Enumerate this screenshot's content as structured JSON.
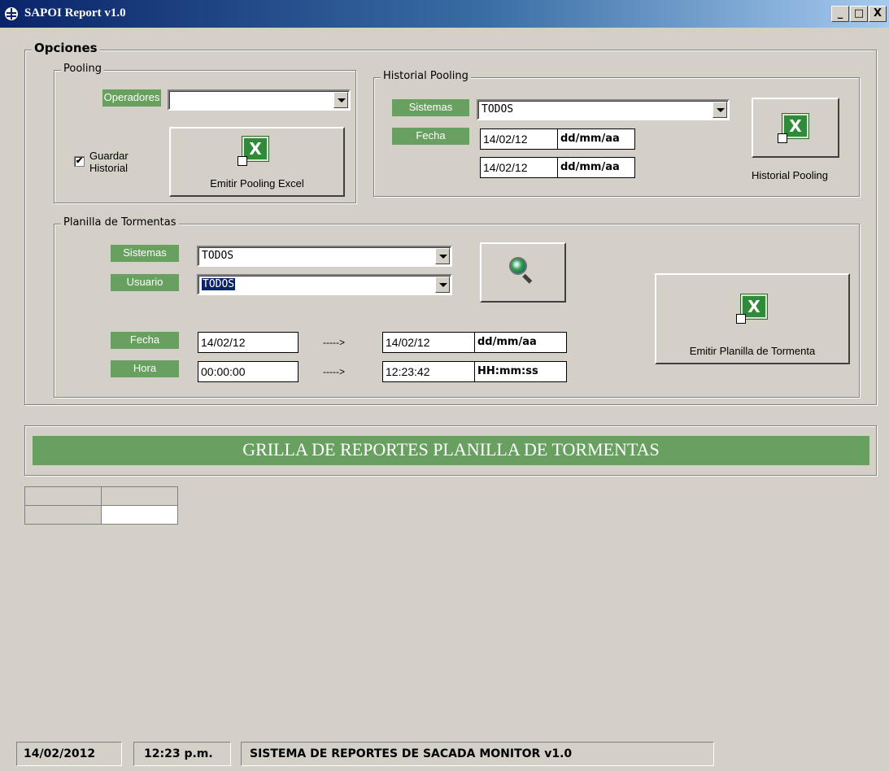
{
  "window": {
    "title": "SAPOI Report v1.0",
    "minimize": "_",
    "maximize": "□",
    "close": "X"
  },
  "opciones": {
    "legend": "Opciones",
    "pooling": {
      "legend": "Pooling",
      "operadores_label": "Operadores",
      "operadores_value": "",
      "guardar_historial_label_1": "Guardar",
      "guardar_historial_label_2": "Historial",
      "guardar_checked": "✔",
      "emitir_button": "Emitir Pooling Excel"
    },
    "historial": {
      "legend": "Historial Pooling",
      "sistemas_label": "Sistemas",
      "sistemas_value": "TODOS",
      "fecha_label": "Fecha",
      "fecha_desde": "14/02/12",
      "fecha_hasta": "14/02/12",
      "date_format": "dd/mm/aa",
      "button_label": "Historial Pooling"
    },
    "planilla": {
      "legend": "Planilla de Tormentas",
      "sistemas_label": "Sistemas",
      "sistemas_value": "TODOS",
      "usuario_label": "Usuario",
      "usuario_value": "TODOS",
      "fecha_label": "Fecha",
      "hora_label": "Hora",
      "fecha_desde": "14/02/12",
      "fecha_hasta": "14/02/12",
      "hora_desde": "00:00:00",
      "hora_hasta": "12:23:42",
      "arrow": "----->",
      "date_format": "dd/mm/aa",
      "time_format": "HH:mm:ss",
      "emitir_button": "Emitir Planilla de Tormenta"
    }
  },
  "grid": {
    "banner": "GRILLA DE REPORTES PLANILLA DE TORMENTAS"
  },
  "statusbar": {
    "date": "14/02/2012",
    "time": "12:23 p.m.",
    "message": "SISTEMA DE REPORTES DE SACADA MONITOR v1.0"
  },
  "icons": {
    "app": "app-globe-icon",
    "excel": "excel-icon",
    "search": "magnifier-icon"
  },
  "colors": {
    "label_green": "#68a060",
    "window_bg": "#d4d0c8",
    "titlebar_start": "#0a246a"
  }
}
